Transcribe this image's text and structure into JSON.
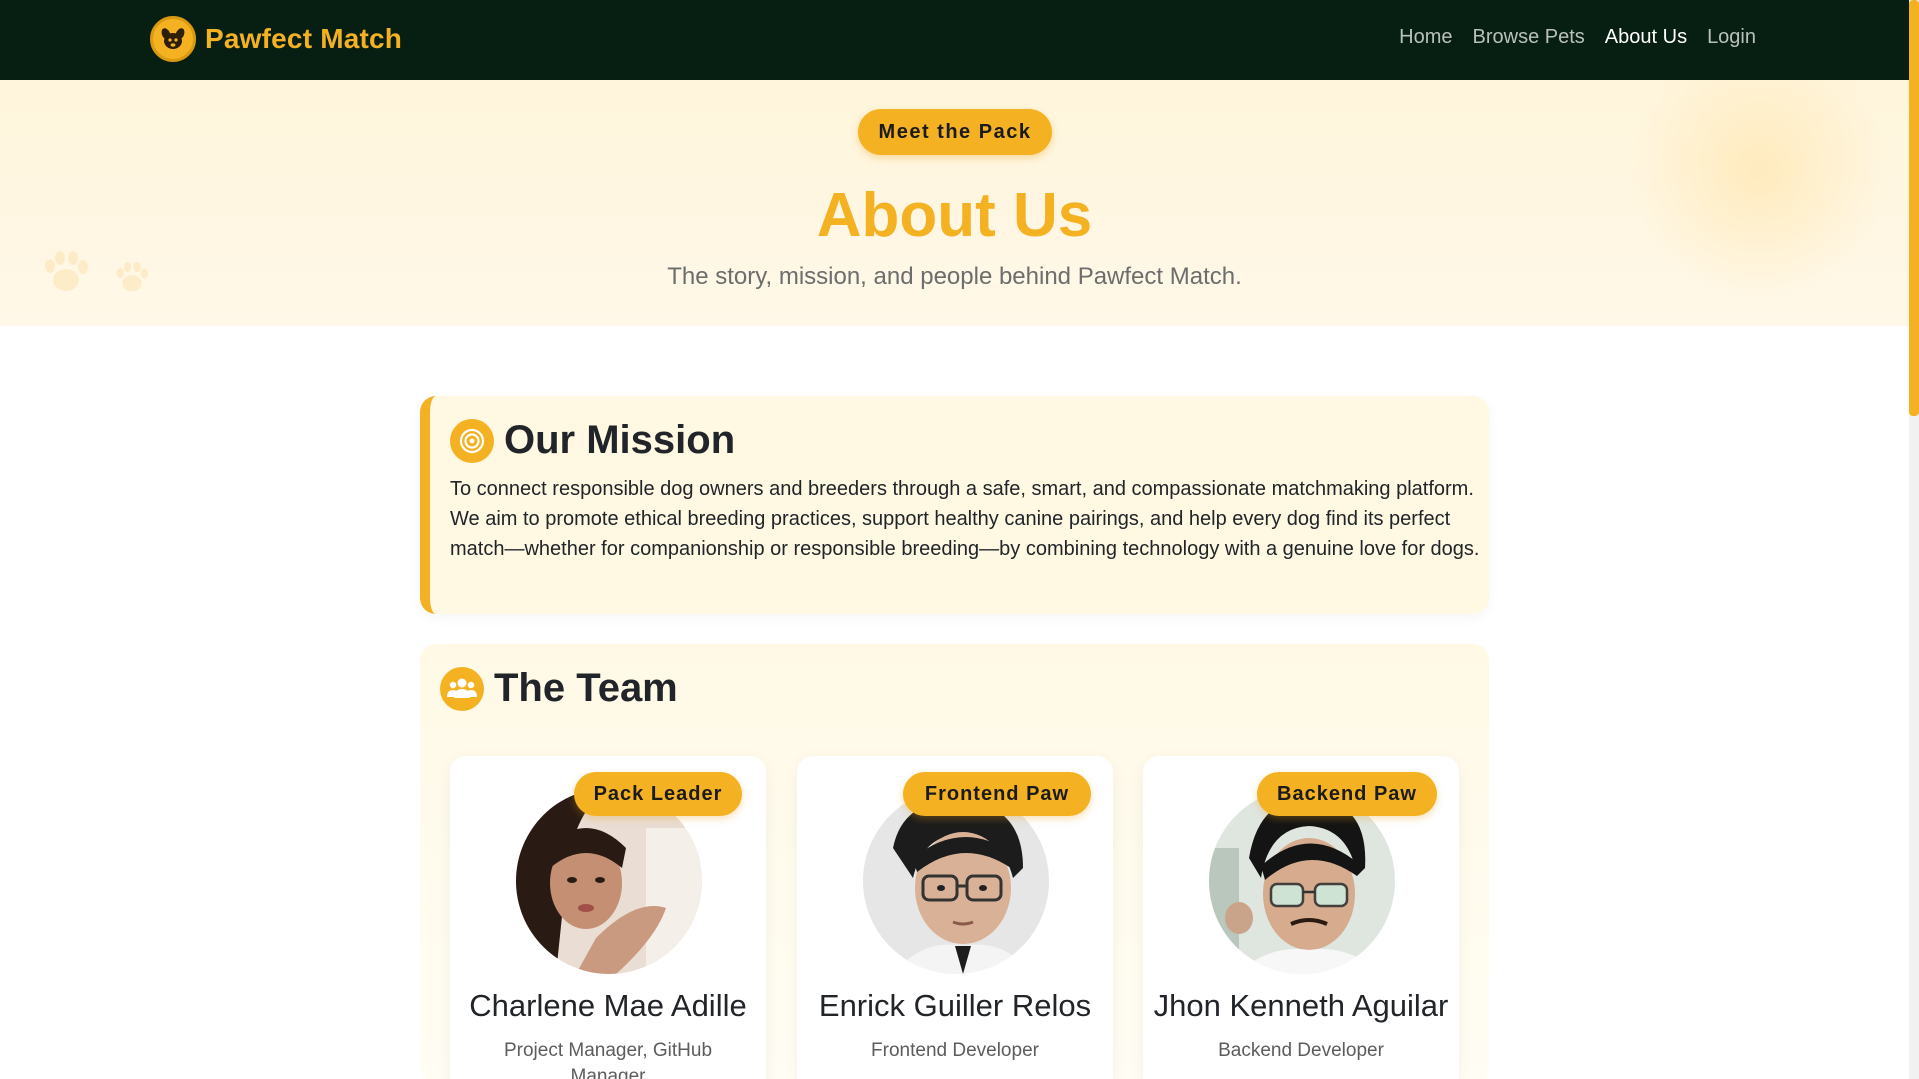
{
  "navbar": {
    "brand": "Pawfect Match",
    "links": [
      "Home",
      "Browse Pets",
      "About Us",
      "Login"
    ],
    "active": "About Us"
  },
  "hero": {
    "pill": "Meet the Pack",
    "title": "About Us",
    "subtitle": "The story, mission, and people behind Pawfect Match."
  },
  "mission": {
    "icon": "target-icon",
    "title": "Our Mission",
    "text": "To connect responsible dog owners and breeders through a safe, smart, and compassionate matchmaking platform. We aim to promote ethical breeding practices, support healthy canine pairings, and help every dog find its perfect match—whether for companionship or responsible breeding—by combining technology with a genuine love for dogs."
  },
  "team": {
    "icon": "users-icon",
    "title": "The Team",
    "members": [
      {
        "badge": "Pack Leader",
        "name": "Charlene Mae Adille",
        "role": "Project Manager, GitHub Manager"
      },
      {
        "badge": "Frontend Paw",
        "name": "Enrick Guiller Relos",
        "role": "Frontend Developer"
      },
      {
        "badge": "Backend Paw",
        "name": "Jhon Kenneth Aguilar",
        "role": "Backend Developer"
      }
    ]
  },
  "colors": {
    "accent": "#f4b223",
    "navbar": "#071e12",
    "hero_bg": "#fff5dc"
  }
}
